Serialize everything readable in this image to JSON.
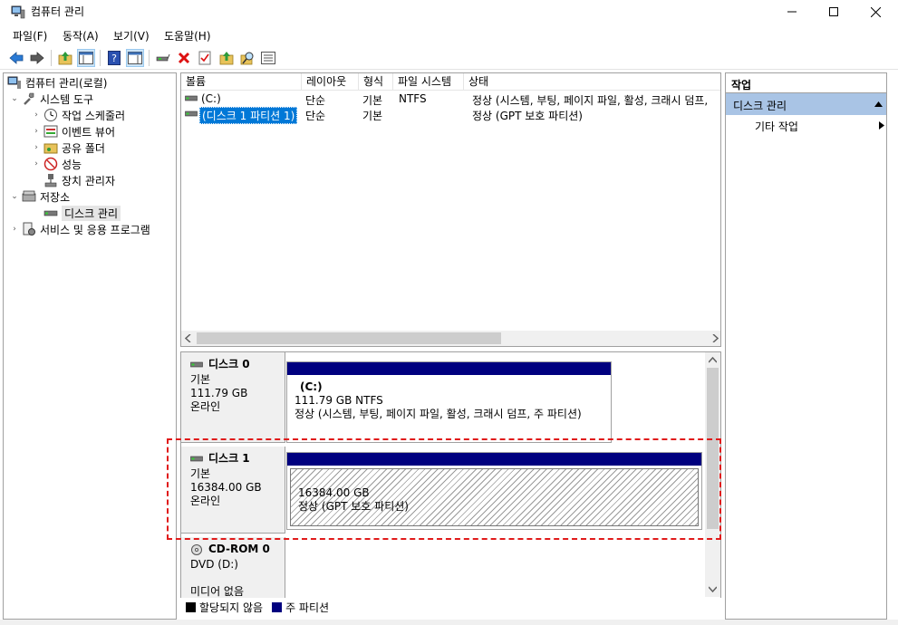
{
  "window": {
    "title": "컴퓨터 관리"
  },
  "menu": {
    "items": [
      "파일(F)",
      "동작(A)",
      "보기(V)",
      "도움말(H)"
    ]
  },
  "toolbar": {
    "icons": [
      "back-arrow-icon",
      "forward-arrow-icon",
      "up-folder-icon",
      "show-hide-tree-icon",
      "help-icon",
      "properties-view-icon",
      "connect-icon",
      "delete-icon",
      "check-icon",
      "upload-icon",
      "search-icon",
      "list-icon"
    ]
  },
  "tree": {
    "root": "컴퓨터 관리(로컬)",
    "system_tools": "시스템 도구",
    "task_scheduler": "작업 스케줄러",
    "event_viewer": "이벤트 뷰어",
    "shared_folders": "공유 폴더",
    "performance": "성능",
    "device_manager": "장치 관리자",
    "storage": "저장소",
    "disk_management": "디스크 관리",
    "services": "서비스 및 응용 프로그램"
  },
  "volumes": {
    "columns": [
      "볼륨",
      "레이아웃",
      "형식",
      "파일 시스템",
      "상태"
    ],
    "rows": [
      {
        "volume": "(C:)",
        "layout": "단순",
        "type": "기본",
        "fs": "NTFS",
        "status": "정상 (시스템, 부팅, 페이지 파일, 활성, 크래시 덤프,"
      },
      {
        "volume": "(디스크 1 파티션 1)",
        "layout": "단순",
        "type": "기본",
        "fs": "",
        "status": "정상 (GPT 보호 파티션)"
      }
    ]
  },
  "disks": [
    {
      "name": "디스크 0",
      "type": "기본",
      "size": "111.79 GB",
      "state": "온라인",
      "part_name": "(C:)",
      "part_size": "111.79 GB NTFS",
      "part_status": "정상 (시스템, 부팅, 페이지 파일, 활성, 크래시 덤프, 주 파티션)"
    },
    {
      "name": "디스크 1",
      "type": "기본",
      "size": "16384.00 GB",
      "state": "온라인",
      "part_name": "",
      "part_size": "16384.00 GB",
      "part_status": "정상 (GPT 보호 파티션)"
    },
    {
      "name": "CD-ROM 0",
      "type": "DVD (D:)",
      "size": "",
      "state": "미디어 없음"
    }
  ],
  "legend": {
    "unallocated": "할당되지 않음",
    "primary": "주 파티션",
    "unallocated_color": "#000000",
    "primary_color": "#00007f"
  },
  "actions": {
    "header": "작업",
    "section": "디스크 관리",
    "more": "기타 작업"
  }
}
